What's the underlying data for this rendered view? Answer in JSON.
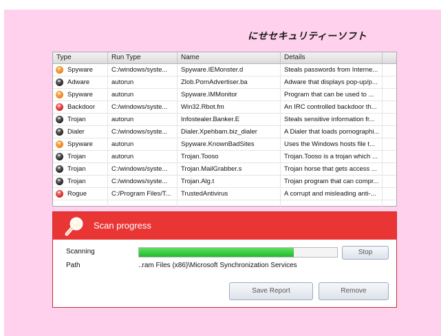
{
  "app": {
    "title": "にせセキュリティーソフト"
  },
  "table": {
    "columns": [
      "Type",
      "Run Type",
      "Name",
      "Details"
    ],
    "rows": [
      {
        "severity": "orange",
        "type": "Spyware",
        "run_type": "C:/windows/syste...",
        "name": "Spyware.IEMonster.d",
        "details": "Steals passwords from Interne..."
      },
      {
        "severity": "black",
        "type": "Adware",
        "run_type": "autorun",
        "name": "Zlob.PornAdvertiser.ba",
        "details": "Adware that displays pop-up/p..."
      },
      {
        "severity": "orange",
        "type": "Spyware",
        "run_type": "autorun",
        "name": "Spyware.IMMonitor",
        "details": "Program that can be used to ..."
      },
      {
        "severity": "red",
        "type": "Backdoor",
        "run_type": "C:/windows/syste...",
        "name": "Win32.Rbot.fm",
        "details": "An IRC controlled backdoor th..."
      },
      {
        "severity": "black",
        "type": "Trojan",
        "run_type": "autorun",
        "name": "Infostealer.Banker.E",
        "details": "Steals sensitive information fr..."
      },
      {
        "severity": "black",
        "type": "Dialer",
        "run_type": "C:/windows/syste...",
        "name": "Dialer.Xpehbam.biz_dialer",
        "details": "A Dialer that loads pornographi..."
      },
      {
        "severity": "orange",
        "type": "Spyware",
        "run_type": "autorun",
        "name": "Spyware.KnownBadSites",
        "details": "Uses the Windows hosts file t..."
      },
      {
        "severity": "black",
        "type": "Trojan",
        "run_type": "autorun",
        "name": "Trojan.Tooso",
        "details": "Trojan.Tooso is a trojan which ..."
      },
      {
        "severity": "black",
        "type": "Trojan",
        "run_type": "C:/windows/syste...",
        "name": "Trojan.MailGrabber.s",
        "details": "Trojan horse that gets access ..."
      },
      {
        "severity": "black",
        "type": "Trojan",
        "run_type": "C:/windows/syste...",
        "name": "Trojan.Alg.t",
        "details": "Trojan program that can compr..."
      },
      {
        "severity": "red",
        "type": "Rogue",
        "run_type": "C:/Program Files/T...",
        "name": "TrustedAntivirus",
        "details": "A corrupt and misleading anti-..."
      }
    ]
  },
  "scan": {
    "title": "Scan progress",
    "scanning_label": "Scanning",
    "path_label": "Path",
    "path_value": "..ram Files (x86)\\Microsoft Synchronization Services",
    "progress": 0.78,
    "stop_label": "Stop",
    "save_report_label": "Save Report",
    "remove_label": "Remove"
  },
  "colors": {
    "background": "#ffd1ec",
    "header_red": "#ea3535",
    "progress_green": "#2cc43a",
    "severity_orange": "#e8801a",
    "severity_black": "#1e1e1e",
    "severity_red": "#d02020"
  },
  "icons": {
    "scan_header": "magnifier-icon"
  }
}
